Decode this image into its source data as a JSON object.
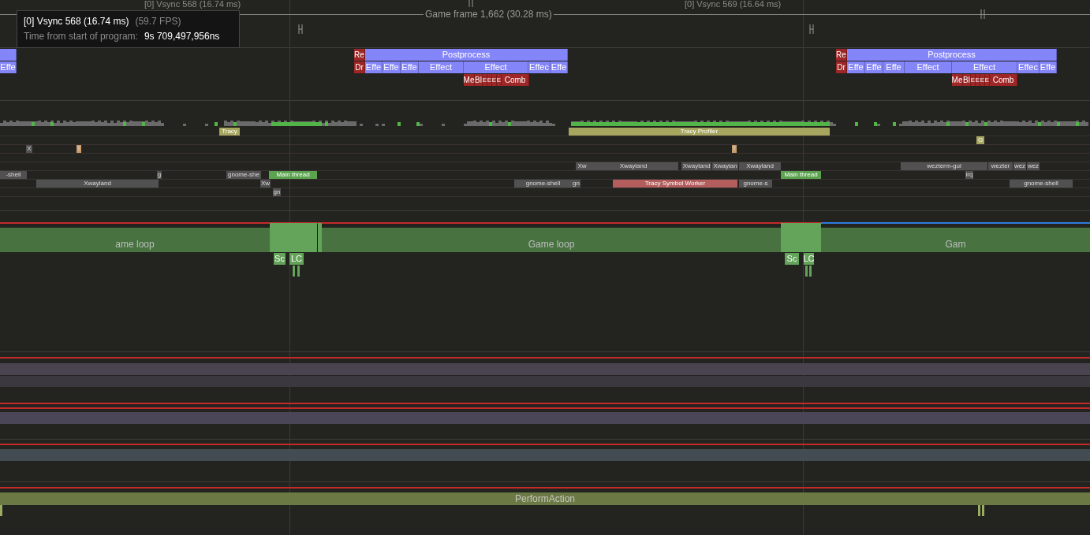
{
  "frame_ruler": {
    "vsync_labels": [
      "[0] Vsync 568 (16.74 ms)",
      "[0] Vsync 569 (16.64 ms)"
    ],
    "game_frame": "Game frame 1,662 (30.28 ms)"
  },
  "tooltip": {
    "title": "[0] Vsync 568 (16.74 ms)",
    "fps": "(59.7 FPS)",
    "label": "Time from start of program:",
    "value": "9s 709,497,956ns"
  },
  "gpu_zones": [
    {
      "text": "Re",
      "kind": "draw"
    },
    {
      "text": "Postprocess",
      "kind": "effect"
    },
    {
      "text": "Re",
      "kind": "draw"
    },
    {
      "text": "Postprocess",
      "kind": "effect"
    },
    {
      "text": "Effe",
      "kind": "effect"
    },
    {
      "text": "Dr",
      "kind": "draw"
    },
    {
      "text": "Effe",
      "kind": "effect"
    },
    {
      "text": "Effe",
      "kind": "effect"
    },
    {
      "text": "Effe",
      "kind": "effect"
    },
    {
      "text": "Effect",
      "kind": "effect"
    },
    {
      "text": "Effect",
      "kind": "effect"
    },
    {
      "text": "Effec",
      "kind": "effect"
    },
    {
      "text": "Effe",
      "kind": "effect"
    },
    {
      "text": "Dr",
      "kind": "draw"
    },
    {
      "text": "Effe",
      "kind": "effect"
    },
    {
      "text": "Effe",
      "kind": "effect"
    },
    {
      "text": "Effe",
      "kind": "effect"
    },
    {
      "text": "Effect",
      "kind": "effect"
    },
    {
      "text": "Effect",
      "kind": "effect"
    },
    {
      "text": "Effec",
      "kind": "effect"
    },
    {
      "text": "Effe",
      "kind": "effect"
    },
    {
      "text": "Me",
      "kind": "draw"
    },
    {
      "text": "Bl",
      "kind": "draw"
    },
    {
      "text": "E",
      "kind": "draw"
    },
    {
      "text": "E",
      "kind": "draw"
    },
    {
      "text": "E",
      "kind": "draw"
    },
    {
      "text": "E",
      "kind": "draw"
    },
    {
      "text": "Comb",
      "kind": "draw"
    },
    {
      "text": "Me",
      "kind": "draw"
    },
    {
      "text": "Bl",
      "kind": "draw"
    },
    {
      "text": "E",
      "kind": "draw"
    },
    {
      "text": "E",
      "kind": "draw"
    },
    {
      "text": "E",
      "kind": "draw"
    },
    {
      "text": "E",
      "kind": "draw"
    },
    {
      "text": "Comb",
      "kind": "draw"
    }
  ],
  "cpu_zones": [
    {
      "text": "Tracy",
      "kind": "profiler"
    },
    {
      "text": "Tracy Profiler",
      "kind": "profiler"
    },
    {
      "text": "G",
      "kind": "profiler"
    },
    {
      "text": "X",
      "kind": "process"
    },
    {
      "text": "T",
      "kind": "marker"
    },
    {
      "text": "T",
      "kind": "marker"
    },
    {
      "text": "Xw",
      "kind": "process"
    },
    {
      "text": "Xwayland",
      "kind": "process"
    },
    {
      "text": "Xwayland",
      "kind": "process"
    },
    {
      "text": "Xwaylan",
      "kind": "process"
    },
    {
      "text": "Xwayland",
      "kind": "process"
    },
    {
      "text": "wezterm-gui",
      "kind": "process"
    },
    {
      "text": "wezter",
      "kind": "process"
    },
    {
      "text": "wez",
      "kind": "process"
    },
    {
      "text": "wez",
      "kind": "process"
    },
    {
      "text": "-shell",
      "kind": "process"
    },
    {
      "text": "g",
      "kind": "process"
    },
    {
      "text": "gnome-she",
      "kind": "process"
    },
    {
      "text": "Main thread",
      "kind": "main"
    },
    {
      "text": "Main thread",
      "kind": "main"
    },
    {
      "text": "irq",
      "kind": "process"
    },
    {
      "text": "Xwayland",
      "kind": "process"
    },
    {
      "text": "Xw",
      "kind": "process"
    },
    {
      "text": "gnome-shell",
      "kind": "process"
    },
    {
      "text": "gn",
      "kind": "process"
    },
    {
      "text": "Tracy Symbol Worker",
      "kind": "symbol"
    },
    {
      "text": "gnome-s",
      "kind": "process"
    },
    {
      "text": "gnome-shell",
      "kind": "process"
    },
    {
      "text": "gn",
      "kind": "process"
    }
  ],
  "game_loop": {
    "zones": [
      {
        "text": "ame loop"
      },
      {
        "text": "Game loop"
      },
      {
        "text": "Gam"
      }
    ],
    "children": [
      {
        "text": "Sc"
      },
      {
        "text": "LC"
      },
      {
        "text": "Sc"
      },
      {
        "text": "LC"
      }
    ]
  },
  "perform_action": "PerformAction"
}
